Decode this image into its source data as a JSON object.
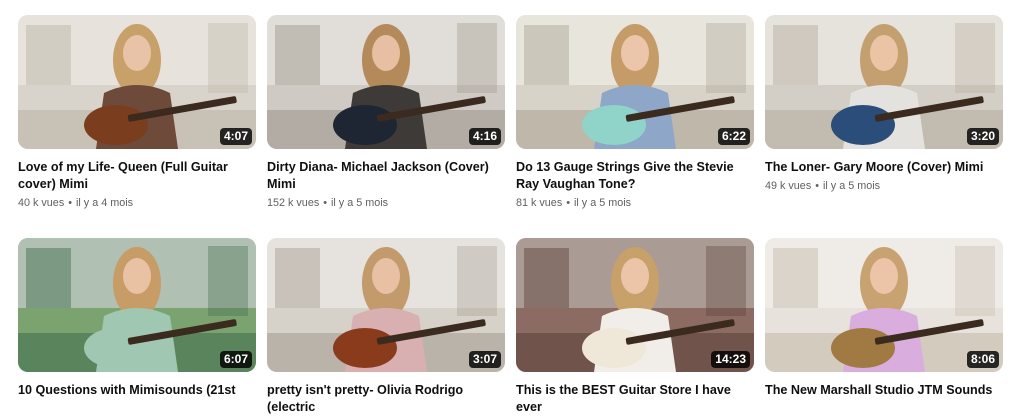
{
  "videos": [
    {
      "title": "Love of my Life- Queen (Full Guitar cover) Mimi",
      "duration": "4:07",
      "views": "40 k vues",
      "age": "il y a 4 mois",
      "scene": {
        "bg": "#d9d4cb",
        "wall": "#ece9e2",
        "top": "#b9b1a4",
        "shirt": "#6e4a3b",
        "hair": "#c8a06a",
        "guitar": "#7a3d1e",
        "skin": "#e9c3a8"
      }
    },
    {
      "title": "Dirty Diana- Michael Jackson (Cover) Mimi",
      "duration": "4:16",
      "views": "152 k vues",
      "age": "il y a 5 mois",
      "scene": {
        "bg": "#cfcac3",
        "wall": "#e8e6e1",
        "top": "#9c948a",
        "shirt": "#3e3a37",
        "hair": "#b58a5a",
        "guitar": "#1e2633",
        "skin": "#e7bfa2"
      }
    },
    {
      "title": "Do 13 Gauge Strings Give the Stevie Ray Vaughan Tone?",
      "duration": "6:22",
      "views": "81 k vues",
      "age": "il y a 5 mois",
      "scene": {
        "bg": "#d8d3c8",
        "wall": "#efece6",
        "top": "#a9a191",
        "shirt": "#8ea6c8",
        "hair": "#c59c68",
        "guitar": "#8fd3c9",
        "skin": "#ecc6aa"
      }
    },
    {
      "title": "The Loner- Gary Moore (Cover) Mimi",
      "duration": "3:20",
      "views": "49 k vues",
      "age": "il y a 5 mois",
      "scene": {
        "bg": "#d3cec6",
        "wall": "#eeebe6",
        "top": "#b5ab9c",
        "shirt": "#e4e2de",
        "hair": "#c4a070",
        "guitar": "#2b4d7a",
        "skin": "#ebc4a6"
      }
    },
    {
      "title": "10 Questions with Mimisounds (21st",
      "duration": "6:07",
      "views": "",
      "age": "",
      "scene": {
        "bg": "#7aa36f",
        "wall": "#c8cdd0",
        "top": "#3f6b4a",
        "shirt": "#9fc7b2",
        "hair": "#c79c66",
        "guitar": "#9fc7b2",
        "skin": "#e9c2a3"
      }
    },
    {
      "title": "pretty isn't pretty- Olivia Rodrigo (electric",
      "duration": "3:07",
      "views": "",
      "age": "",
      "scene": {
        "bg": "#d6d1c9",
        "wall": "#ecebe8",
        "top": "#a39a8f",
        "shirt": "#d9b0b2",
        "hair": "#c29a6b",
        "guitar": "#8a3b1c",
        "skin": "#e8c0a4"
      }
    },
    {
      "title": "This is the BEST Guitar Store I have ever",
      "duration": "14:23",
      "views": "",
      "age": "",
      "scene": {
        "bg": "#8c6b63",
        "wall": "#b7b1aa",
        "top": "#5a3f39",
        "shirt": "#f1eeea",
        "hair": "#c7a06a",
        "guitar": "#efe7d8",
        "skin": "#ecc5a8"
      }
    },
    {
      "title": "The New Marshall Studio JTM Sounds",
      "duration": "8:06",
      "views": "",
      "age": "",
      "scene": {
        "bg": "#e7e3dc",
        "wall": "#f2f0ec",
        "top": "#c3b8a6",
        "shirt": "#d9aede",
        "hair": "#c9a272",
        "guitar": "#a07a42",
        "skin": "#ecc5a8"
      }
    }
  ]
}
